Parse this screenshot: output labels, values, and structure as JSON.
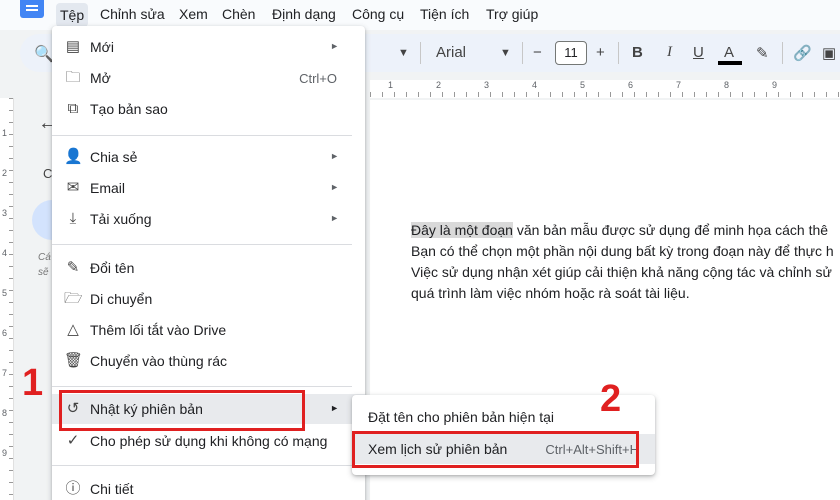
{
  "menubar": {
    "items": [
      "Tệp",
      "Chỉnh sửa",
      "Xem",
      "Chèn",
      "Định dạng",
      "Công cụ",
      "Tiện ích",
      "Trợ giúp"
    ]
  },
  "toolbar": {
    "font_name": "Arial",
    "font_size": "11",
    "minus": "−",
    "plus": "+",
    "bold": "B",
    "italic": "I",
    "underline": "U",
    "text_color": "A"
  },
  "ruler": {
    "numbers": [
      "1",
      "2",
      "3",
      "4",
      "5",
      "6",
      "7",
      "8",
      "9"
    ]
  },
  "vruler": {
    "numbers": [
      "1",
      "2",
      "3",
      "4",
      "5",
      "6",
      "7",
      "8",
      "9"
    ]
  },
  "left_panel": {
    "letter": "C",
    "small_text_1": "Cá",
    "small_text_2": "sẽ"
  },
  "file_menu": {
    "new": "Mới",
    "open": "Mở",
    "open_shortcut": "Ctrl+O",
    "copy": "Tạo bản sao",
    "share": "Chia sẻ",
    "email": "Email",
    "download": "Tải xuống",
    "rename": "Đổi tên",
    "move": "Di chuyển",
    "shortcut": "Thêm lối tắt vào Drive",
    "trash": "Chuyển vào thùng rác",
    "version_history": "Nhật ký phiên bản",
    "offline": "Cho phép sử dụng khi không có mạng",
    "details": "Chi tiết"
  },
  "submenu": {
    "name_version": "Đặt tên cho phiên bản hiện tại",
    "see_history": "Xem lịch sử phiên bản",
    "see_history_shortcut": "Ctrl+Alt+Shift+H"
  },
  "document": {
    "highlighted": "Đây là một đoạn",
    "line1_rest": " văn bản mẫu được sử dụng để minh họa cách thê",
    "line2": "Bạn có thể chọn một phần nội dung bất kỳ trong đoạn này để thực h",
    "line3": "Việc sử dụng nhận xét giúp cải thiện khả năng cộng tác và chỉnh sử",
    "line4": "quá trình làm việc nhóm hoặc rà soát tài liệu."
  },
  "callouts": {
    "one": "1",
    "two": "2"
  },
  "colors": {
    "accent_red": "#e02020",
    "highlight": "#d9d9d9"
  }
}
